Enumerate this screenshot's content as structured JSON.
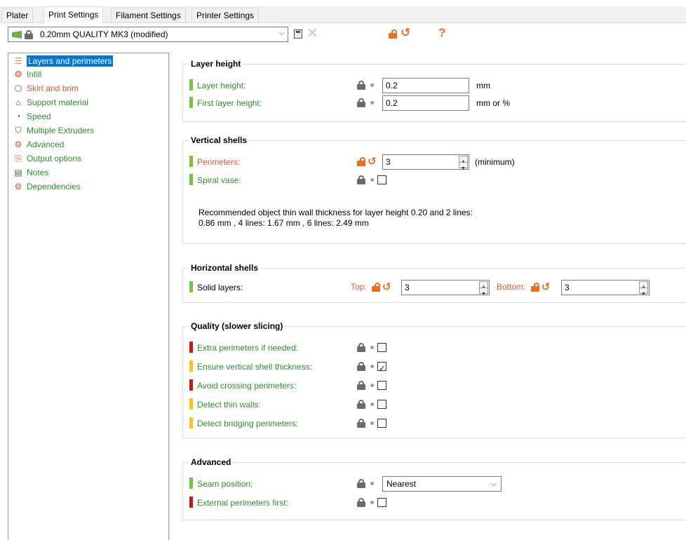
{
  "tabs": [
    "Plater",
    "Print Settings",
    "Filament Settings",
    "Printer Settings"
  ],
  "preset": {
    "name": "0.20mm QUALITY MK3 (modified)",
    "caret": "⌵"
  },
  "toolbar": {
    "delete": "✕",
    "undo": "↺",
    "help": "?"
  },
  "tree": [
    {
      "label": "Layers and perimeters",
      "icon": "layers-icon",
      "glyph": "☰"
    },
    {
      "label": "Infill",
      "icon": "infill-icon",
      "glyph": "❂"
    },
    {
      "label": "Skirt and brim",
      "icon": "skirt-icon",
      "glyph": "⬡"
    },
    {
      "label": "Support material",
      "icon": "support-icon",
      "glyph": "⌂"
    },
    {
      "label": "Speed",
      "icon": "speed-icon",
      "glyph": "◔"
    },
    {
      "label": "Multiple Extruders",
      "icon": "funnel-icon",
      "glyph": "⛉"
    },
    {
      "label": "Advanced",
      "icon": "wrench-icon",
      "glyph": "⚙"
    },
    {
      "label": "Output options",
      "icon": "output-icon",
      "glyph": "⎘"
    },
    {
      "label": "Notes",
      "icon": "notes-icon",
      "glyph": "▤"
    },
    {
      "label": "Dependencies",
      "icon": "dependencies-icon",
      "glyph": "⚙"
    }
  ],
  "layer_height": {
    "title": "Layer height",
    "layer_height_label": "Layer height:",
    "layer_height_value": "0.2",
    "layer_height_unit": "mm",
    "first_layer_label": "First layer height:",
    "first_layer_value": "0.2",
    "first_layer_unit": "mm or %"
  },
  "vertical_shells": {
    "title": "Vertical shells",
    "perimeters_label": "Perimeters:",
    "perimeters_value": "3",
    "perimeters_unit": "(minimum)",
    "spiral_label": "Spiral vase:",
    "note_line1": "Recommended object thin wall thickness for layer height 0.20 and 2 lines:",
    "note_line2": "0.86 mm , 4 lines: 1.67 mm , 6 lines: 2.49 mm"
  },
  "horizontal_shells": {
    "title": "Horizontal shells",
    "solid_label": "Solid layers:",
    "top_label": "Top:",
    "top_value": "3",
    "bottom_label": "Bottom:",
    "bottom_value": "3"
  },
  "quality": {
    "title": "Quality (slower slicing)",
    "extra_label": "Extra perimeters if needed:",
    "ensure_label": "Ensure vertical shell thickness:",
    "avoid_label": "Avoid crossing perimeters:",
    "thin_label": "Detect thin walls:",
    "bridging_label": "Detect bridging perimeters:",
    "ensure_checked": true
  },
  "advanced": {
    "title": "Advanced",
    "seam_label": "Seam position:",
    "seam_value": "Nearest",
    "external_label": "External perimeters first:"
  },
  "colors": {
    "selected": "#0078d7",
    "modified": "#e4572e",
    "system_green": "#2f8f2f",
    "marker_simple": "#75c540",
    "marker_advanced": "#fcc419",
    "marker_expert": "#c8191f"
  }
}
